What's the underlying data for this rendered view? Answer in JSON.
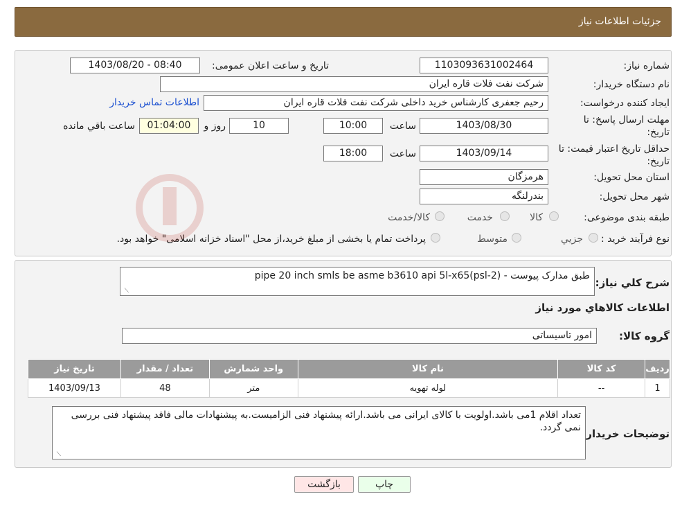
{
  "header": {
    "title": "جزئیات اطلاعات نیاز"
  },
  "form": {
    "need_number_label": "شماره نیاز:",
    "need_number": "1103093631002464",
    "announce_label": "تاریخ و ساعت اعلان عمومی:",
    "announce_value": "1403/08/20 - 08:40",
    "buyer_label": "نام دستگاه خریدار:",
    "buyer_value": "شرکت نفت فلات قاره ایران",
    "creator_label": "ایجاد کننده درخواست:",
    "creator_value": "رحیم جعفری کارشناس خرید داخلی شرکت نفت فلات قاره ایران",
    "contact_link": "اطلاعات تماس خریدار",
    "deadline_label_1": "مهلت ارسال پاسخ: تا",
    "deadline_label_2": "تاریخ:",
    "deadline_date": "1403/08/30",
    "time_label": "ساعت",
    "deadline_time": "10:00",
    "days_value": "10",
    "days_label": "روز و",
    "remaining_value": "01:04:00",
    "remaining_label": "ساعت باقي مانده",
    "validity_label_1": "حداقل تاریخ اعتبار قیمت: تا",
    "validity_label_2": "تاریخ:",
    "validity_date": "1403/09/14",
    "validity_time": "18:00",
    "province_label": "استان محل تحویل:",
    "province_value": "هرمزگان",
    "city_label": "شهر محل تحویل:",
    "city_value": "بندرلنگه",
    "category_label": "طبقه بندی موضوعی:",
    "category_options": [
      "کالا",
      "خدمت",
      "کالا/خدمت"
    ],
    "process_label": "نوع فرآیند خرید :",
    "process_options": [
      "جزیي",
      "متوسط"
    ],
    "process_note": "پرداخت تمام یا بخشی از مبلغ خرید،از محل \"اسناد خزانه اسلامی\" خواهد بود."
  },
  "details": {
    "summary_label": "شرح کلي نیاز:",
    "summary_value": "طبق مدارک پیوست  -  pipe 20 inch smls be asme b3610 api 5l-x65(psl-2)",
    "goods_info_title": "اطلاعات کالاهاي مورد نیاز",
    "group_label": "گروه کالا:",
    "group_value": "امور تاسیساتی",
    "table_headers": [
      "ردیف",
      "کد کالا",
      "نام کالا",
      "واحد شمارش",
      "تعداد / مقدار",
      "تاریخ نیاز"
    ],
    "table_rows": [
      [
        "1",
        "--",
        "لوله تهویه",
        "متر",
        "48",
        "1403/09/13"
      ]
    ],
    "buyer_notes_label": "توضیحات خریدار:",
    "buyer_notes_value": "تعداد اقلام 1می باشد.اولویت با کالای ایرانی می باشد.ارائه پیشنهاد فنی الزامیست.به پیشنهادات مالی فاقد پیشنهاد فنی بررسی نمی گردد."
  },
  "buttons": {
    "print": "چاپ",
    "back": "بازگشت"
  },
  "colors": {
    "header": "#8a6a3f",
    "link": "#1a4fd0",
    "table_header": "#9b9b9b"
  }
}
